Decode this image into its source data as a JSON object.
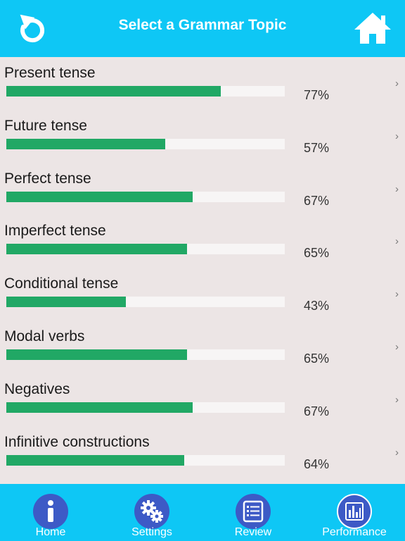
{
  "header": {
    "title": "Select a Grammar Topic",
    "back_icon": "undo-arrow-icon",
    "home_icon": "house-icon",
    "color": "#0ec7f5"
  },
  "topics": [
    {
      "name": "Present tense",
      "percent_label": "77%",
      "progress": 0.77
    },
    {
      "name": "Future tense",
      "percent_label": "57%",
      "progress": 0.57
    },
    {
      "name": "Perfect tense",
      "percent_label": "67%",
      "progress": 0.67
    },
    {
      "name": "Imperfect tense",
      "percent_label": "65%",
      "progress": 0.65
    },
    {
      "name": "Conditional tense",
      "percent_label": "43%",
      "progress": 0.43
    },
    {
      "name": "Modal verbs",
      "percent_label": "65%",
      "progress": 0.65
    },
    {
      "name": "Negatives",
      "percent_label": "67%",
      "progress": 0.67
    },
    {
      "name": "Infinitive constructions",
      "percent_label": "64%",
      "progress": 0.64
    }
  ],
  "progress_color": "#21a865",
  "tabs": [
    {
      "label": "Home",
      "icon": "info-icon",
      "active": false
    },
    {
      "label": "Settings",
      "icon": "gears-icon",
      "active": false
    },
    {
      "label": "Review",
      "icon": "checklist-icon",
      "active": false
    },
    {
      "label": "Performance",
      "icon": "bar-chart-icon",
      "active": true
    }
  ]
}
